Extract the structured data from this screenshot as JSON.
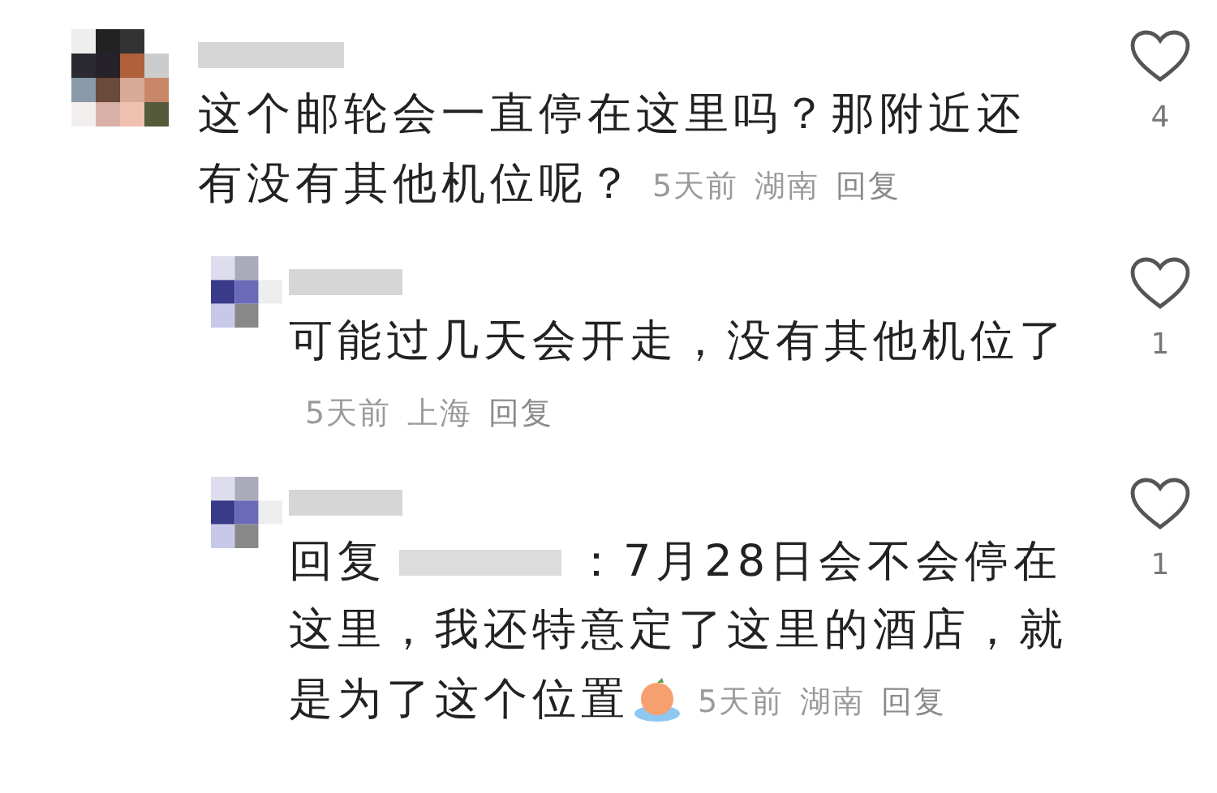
{
  "comments": [
    {
      "kind": "comment",
      "lines": [
        "这个邮轮会一直停在这里吗？那附近还",
        "有没有其他机位呢？"
      ],
      "time": "5天前",
      "location": "湖南",
      "reply_label": "回复",
      "likes": "4",
      "liked": false
    },
    {
      "kind": "reply",
      "lines": [
        "可能过几天会开走，没有其他机位了"
      ],
      "time": "5天前",
      "location": "上海",
      "reply_label": "回复",
      "likes": "1",
      "liked": false
    },
    {
      "kind": "reply",
      "prefix": "回复",
      "lines": [
        "：7月28日会不会停在",
        "这里，我还特意定了这里的酒店，就",
        "是为了这个位置"
      ],
      "emoji": true,
      "time": "5天前",
      "location": "湖南",
      "reply_label": "回复",
      "likes": "1",
      "liked": false
    }
  ]
}
